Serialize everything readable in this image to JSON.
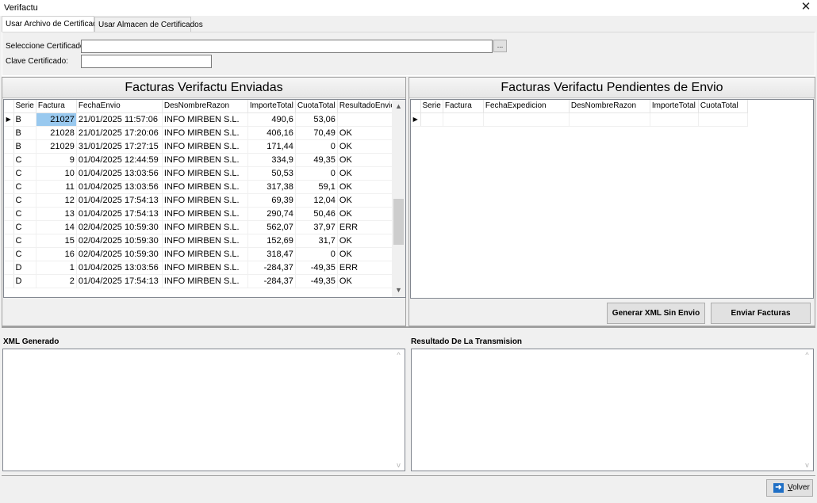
{
  "window": {
    "title": "Verifactu"
  },
  "tabs": [
    {
      "label": "Usar Archivo de Certificado"
    },
    {
      "label": "Usar Almacen de Certificados"
    }
  ],
  "cert": {
    "file_label": "Seleccione Certificado:",
    "file_value": "",
    "browse_label": "...",
    "pass_label": "Clave Certificado:",
    "pass_value": ""
  },
  "sent": {
    "header": "Facturas Verifactu Enviadas",
    "columns": [
      "Serie",
      "Factura",
      "FechaEnvio",
      "DesNombreRazon",
      "ImporteTotal",
      "CuotaTotal",
      "ResultadoEnvio"
    ],
    "rows": [
      [
        "B",
        "21027",
        "21/01/2025 11:57:06",
        "INFO MIRBEN S.L.",
        "490,6",
        "53,06",
        ""
      ],
      [
        "B",
        "21028",
        "21/01/2025 17:20:06",
        "INFO MIRBEN S.L.",
        "406,16",
        "70,49",
        "OK"
      ],
      [
        "B",
        "21029",
        "31/01/2025 17:27:15",
        "INFO MIRBEN S.L.",
        "171,44",
        "0",
        "OK"
      ],
      [
        "C",
        "9",
        "01/04/2025 12:44:59",
        "INFO MIRBEN S.L.",
        "334,9",
        "49,35",
        "OK"
      ],
      [
        "C",
        "10",
        "01/04/2025 13:03:56",
        "INFO MIRBEN S.L.",
        "50,53",
        "0",
        "OK"
      ],
      [
        "C",
        "11",
        "01/04/2025 13:03:56",
        "INFO MIRBEN S.L.",
        "317,38",
        "59,1",
        "OK"
      ],
      [
        "C",
        "12",
        "01/04/2025 17:54:13",
        "INFO MIRBEN S.L.",
        "69,39",
        "12,04",
        "OK"
      ],
      [
        "C",
        "13",
        "01/04/2025 17:54:13",
        "INFO MIRBEN S.L.",
        "290,74",
        "50,46",
        "OK"
      ],
      [
        "C",
        "14",
        "02/04/2025 10:59:30",
        "INFO MIRBEN S.L.",
        "562,07",
        "37,97",
        "ERR"
      ],
      [
        "C",
        "15",
        "02/04/2025 10:59:30",
        "INFO MIRBEN S.L.",
        "152,69",
        "31,7",
        "OK"
      ],
      [
        "C",
        "16",
        "02/04/2025 10:59:30",
        "INFO MIRBEN S.L.",
        "318,47",
        "0",
        "OK"
      ],
      [
        "D",
        "1",
        "01/04/2025 13:03:56",
        "INFO MIRBEN S.L.",
        "-284,37",
        "-49,35",
        "ERR"
      ],
      [
        "D",
        "2",
        "01/04/2025 17:54:13",
        "INFO MIRBEN S.L.",
        "-284,37",
        "-49,35",
        "OK"
      ]
    ]
  },
  "pending": {
    "header": "Facturas Verifactu Pendientes de Envio",
    "columns": [
      "Serie",
      "Factura",
      "FechaExpedicion",
      "DesNombreRazon",
      "ImporteTotal",
      "CuotaTotal"
    ]
  },
  "buttons": {
    "generate": "Generar XML Sin Envio",
    "send": "Enviar Facturas",
    "back": "Volver"
  },
  "xml": {
    "title": "XML Generado",
    "value": ""
  },
  "result": {
    "title": "Resultado De La Transmision",
    "value": ""
  },
  "icons": {
    "close": "close-icon",
    "back": "exit-arrow-icon",
    "row_current": "row-pointer-icon"
  }
}
